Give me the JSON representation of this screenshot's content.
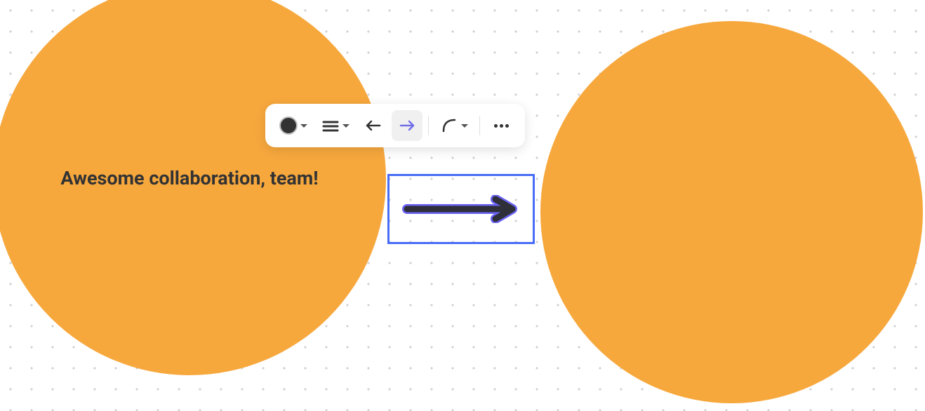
{
  "canvas": {
    "shapes": {
      "left_circle": {
        "text": "Awesome collaboration, team!",
        "fill": "#f7a83d"
      },
      "right_circle": {
        "fill": "#f7a83d"
      },
      "arrow": {
        "stroke": "#2f2f3a",
        "outline": "#6a62f4",
        "direction": "right"
      }
    },
    "selection": {
      "color": "#476df6"
    }
  },
  "toolbar": {
    "color": {
      "swatch": "#333333"
    },
    "line_style": {
      "icon": "line-weight-icon"
    },
    "arrow_start": {
      "icon": "arrow-left-icon",
      "active": false
    },
    "arrow_end": {
      "icon": "arrow-right-icon",
      "active": true,
      "active_color": "#716ee8"
    },
    "corner_style": {
      "icon": "rounded-corner-icon"
    },
    "more": {
      "icon": "more-icon"
    }
  }
}
